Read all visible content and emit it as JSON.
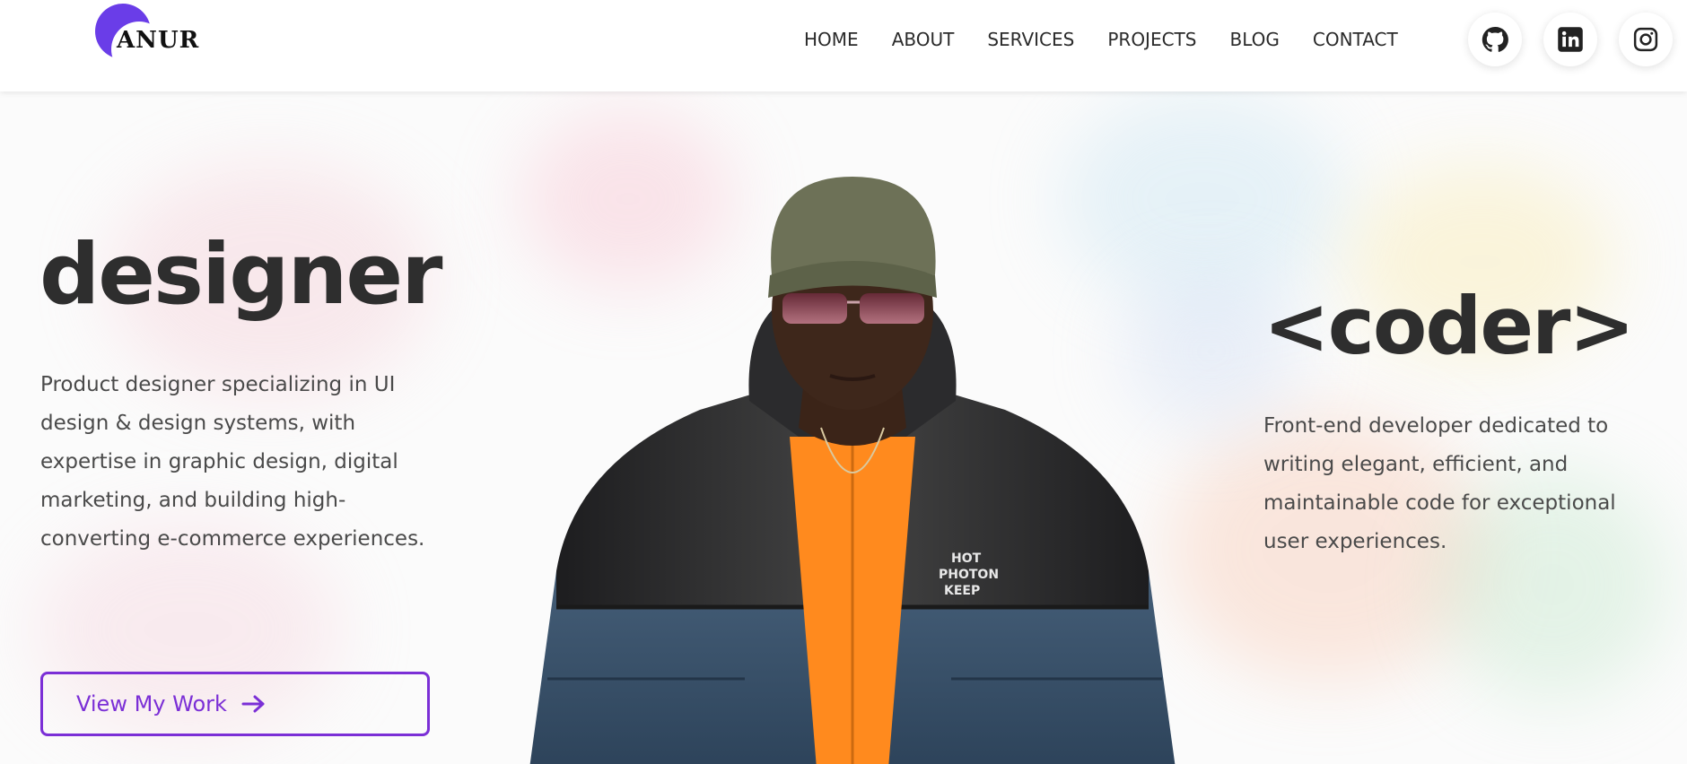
{
  "header": {
    "logo_text": "ANUR",
    "nav": [
      {
        "label": "HOME"
      },
      {
        "label": "ABOUT"
      },
      {
        "label": "SERVICES"
      },
      {
        "label": "PROJECTS"
      },
      {
        "label": "BLOG"
      },
      {
        "label": "CONTACT"
      }
    ],
    "social": [
      {
        "name": "github-icon"
      },
      {
        "name": "linkedin-icon"
      },
      {
        "name": "instagram-icon"
      }
    ]
  },
  "hero": {
    "left_title": "designer",
    "left_description": "Product designer specializing in UI design & design systems, with expertise in graphic design, digital marketing, and building high-converting e-commerce experiences.",
    "cta_label": "View My Work",
    "right_title": "<coder>",
    "right_description": "Front-end developer dedicated to writing elegant, efficient, and maintainable code for exceptional user experiences.",
    "jacket_text": [
      "HOT",
      "PHOTON",
      "KEEP"
    ]
  },
  "colors": {
    "accent": "#7b2fd6",
    "logo": "#6a3de8",
    "text_dark": "#2e2e2e",
    "text_body": "#4a4a4a"
  }
}
